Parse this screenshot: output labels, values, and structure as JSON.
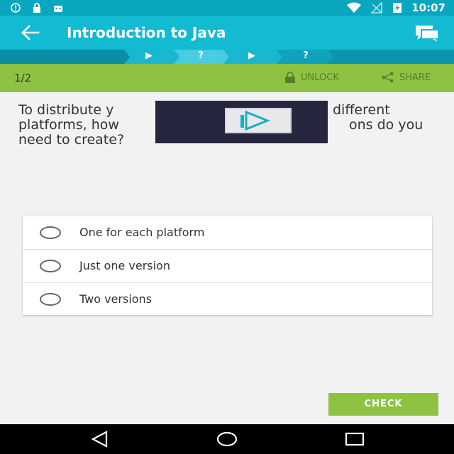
{
  "status_bar": {
    "time": "10:07",
    "left_icons": [
      "alert-icon",
      "lock-icon",
      "android-icon"
    ],
    "right_icons": [
      "wifi-icon",
      "no-signal-icon",
      "battery-charging-icon"
    ]
  },
  "app_bar": {
    "title": "Introduction to Java",
    "back_icon": "arrow-left-icon",
    "chat_icon": "chat-bubbles-icon"
  },
  "progress_steps": [
    "▶",
    "?",
    "▶",
    "?"
  ],
  "info_bar": {
    "counter": "1/2",
    "unlock_label": "UNLOCK",
    "share_label": "SHARE"
  },
  "question": {
    "line1": "To distribute y",
    "line1_end": "different",
    "line2": "platforms, how",
    "line2_end": "ons do you",
    "line3": "need to create?"
  },
  "options": [
    {
      "label": "One for each platform"
    },
    {
      "label": "Just one version"
    },
    {
      "label": "Two versions"
    }
  ],
  "check_label": "CHECK",
  "colors": {
    "status_bar": "#0aa6bf",
    "app_bar": "#12bad2",
    "progress_strip": "#0b95ac",
    "accent_green": "#8fc243",
    "background": "#f2f2f2"
  }
}
